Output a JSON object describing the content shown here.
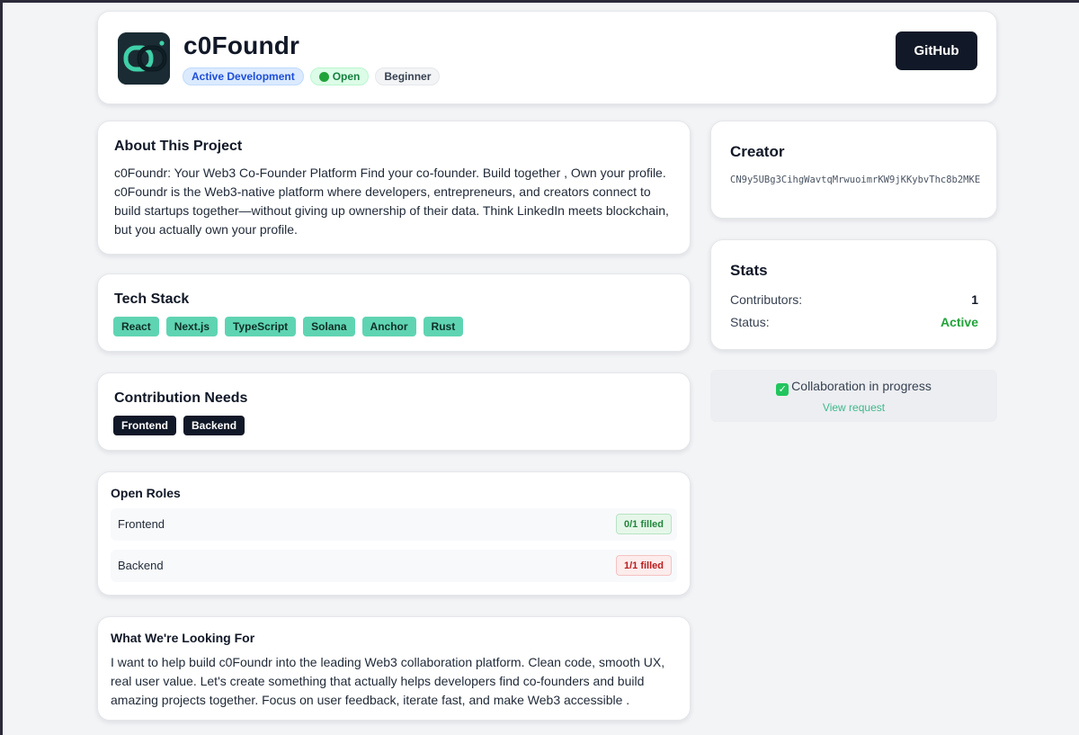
{
  "project": {
    "title": "c0Foundr",
    "badges": [
      {
        "label": "Active Development"
      },
      {
        "label": "Open"
      },
      {
        "label": "Beginner"
      }
    ],
    "github_label": "GitHub"
  },
  "about": {
    "title": "About This Project",
    "text": "c0Foundr: Your Web3 Co-Founder Platform Find your co-founder. Build together , Own your profile. c0Foundr is the Web3-native platform where developers, entrepreneurs, and creators connect to build startups together—without giving up ownership of their data. Think LinkedIn meets blockchain, but you actually own your profile."
  },
  "tech_stack": {
    "title": "Tech Stack",
    "items": [
      "React",
      "Next.js",
      "TypeScript",
      "Solana",
      "Anchor",
      "Rust"
    ]
  },
  "contribution_needs": {
    "title": "Contribution Needs",
    "items": [
      "Frontend",
      "Backend"
    ]
  },
  "open_roles": {
    "title": "Open Roles",
    "roles": [
      {
        "name": "Frontend",
        "status": "0/1 filled"
      },
      {
        "name": "Backend",
        "status": "1/1 filled"
      }
    ]
  },
  "looking_for": {
    "title": "What We're Looking For",
    "text": "I want to help build c0Foundr into the leading Web3 collaboration platform. Clean code, smooth UX, real user value. Let's create something that actually helps developers find co-founders and build amazing projects together. Focus on user feedback, iterate fast, and make Web3 accessible ."
  },
  "creator": {
    "title": "Creator",
    "address": "CN9y5UBg3CihgWavtqMrwuoimrKW9jKKybvThc8b2MKE"
  },
  "stats": {
    "title": "Stats",
    "contributors_label": "Contributors:",
    "contributors_value": "1",
    "status_label": "Status:",
    "status_value": "Active"
  },
  "collaboration": {
    "message": "Collaboration in progress",
    "link": "View request"
  },
  "colors": {
    "accent_teal": "#5fd4b3",
    "dark": "#111827",
    "active_green": "#22a33a",
    "filled_ok_green": "#22863a",
    "filled_full_red": "#b91c1c",
    "link_green": "#3fb88a"
  },
  "icons": {
    "logo": "c0foundr-logo",
    "open_dot": "green-dot-icon",
    "collab_check": "check-mark-icon"
  }
}
